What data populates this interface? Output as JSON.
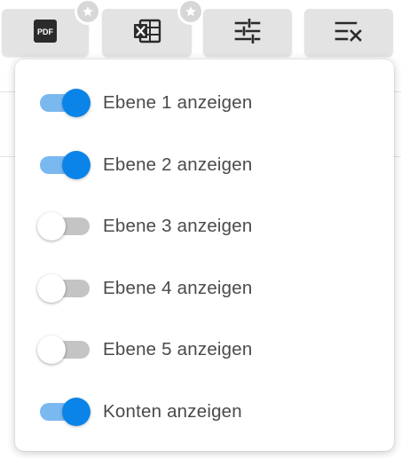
{
  "toolbar": {
    "buttons": [
      {
        "name": "pdf-export",
        "icon": "pdf-icon",
        "badge": "star-icon"
      },
      {
        "name": "excel-export",
        "icon": "excel-icon",
        "badge": "star-icon"
      },
      {
        "name": "filter-settings",
        "icon": "sliders-icon"
      },
      {
        "name": "layer-options",
        "icon": "checklist-icon"
      }
    ],
    "pdf_icon_text": "PDF"
  },
  "dropdown": {
    "items": [
      {
        "label": "Ebene 1 anzeigen",
        "checked": true
      },
      {
        "label": "Ebene 2 anzeigen",
        "checked": true
      },
      {
        "label": "Ebene 3 anzeigen",
        "checked": false
      },
      {
        "label": "Ebene 4 anzeigen",
        "checked": false
      },
      {
        "label": "Ebene 5 anzeigen",
        "checked": false
      },
      {
        "label": "Konten anzeigen",
        "checked": true
      }
    ]
  },
  "colors": {
    "accent": "#0a84e8",
    "accent_track": "#7ab8f0",
    "off_track": "#c4c4c4",
    "button_bg": "#e3e3e3"
  }
}
